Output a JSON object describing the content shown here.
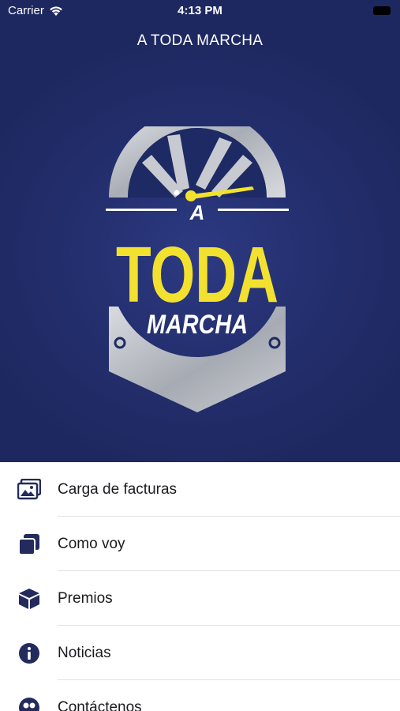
{
  "status_bar": {
    "carrier": "Carrier",
    "time": "4:13 PM"
  },
  "nav": {
    "title": "A TODA MARCHA"
  },
  "logo": {
    "letter_a": "A",
    "word_toda": "TODA",
    "word_marcha": "MARCHA",
    "colors": {
      "yellow": "#f3e130",
      "silver": "#b9bcc3",
      "navy": "#1e2a63"
    }
  },
  "menu": {
    "items": [
      {
        "label": "Carga de facturas",
        "icon": "photo-gallery-icon"
      },
      {
        "label": "Como voy",
        "icon": "stacked-squares-icon"
      },
      {
        "label": "Premios",
        "icon": "box-icon"
      },
      {
        "label": "Noticias",
        "icon": "info-icon"
      },
      {
        "label": "Contáctenos",
        "icon": "contacts-icon"
      }
    ]
  },
  "colors": {
    "header_background": "#222c6a",
    "icon_color": "#232a5c",
    "text_color": "#1b1b1f"
  }
}
